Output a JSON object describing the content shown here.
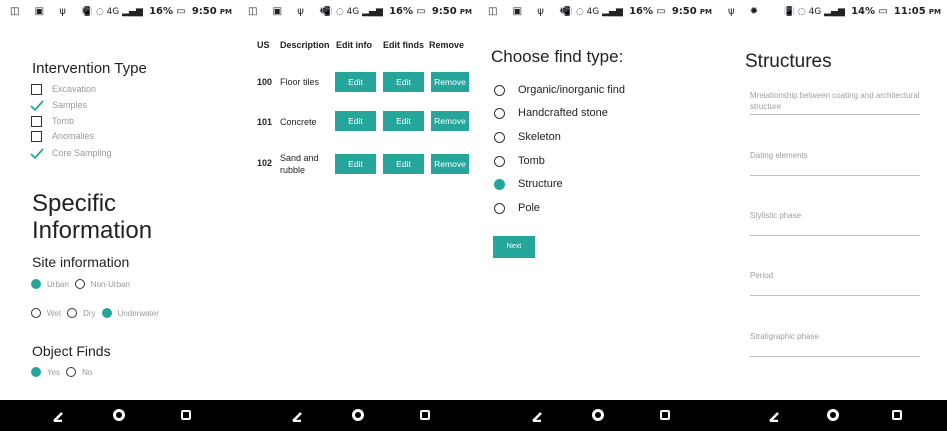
{
  "accent_color": "#26a69a",
  "status_bars": [
    {
      "left_icons": "◫ ▣ ψ ✹",
      "signal_icons": "📳 ◌ 4G ▂▄▆",
      "battery_percent": "16%",
      "battery_icon": "▭",
      "time": "9:50",
      "ampm": "PM"
    },
    {
      "left_icons": "◫ ▣ ψ ✹",
      "signal_icons": "📳 ◌ 4G ▂▄▆",
      "battery_percent": "16%",
      "battery_icon": "▭",
      "time": "9:50",
      "ampm": "PM"
    },
    {
      "left_icons": "◫ ▣ ψ ✹",
      "signal_icons": "📳 ◌ 4G ▂▄▆",
      "battery_percent": "16%",
      "battery_icon": "▭",
      "time": "9:50",
      "ampm": "PM"
    },
    {
      "left_icons": "ψ ✹",
      "signal_icons": "📳 ◌ 4G ▂▄▆",
      "battery_percent": "14%",
      "battery_icon": "▭",
      "time": "11:05",
      "ampm": "PM"
    }
  ],
  "screen1": {
    "intervention_title": "Intervention Type",
    "intervention_items": [
      {
        "label": "Excavation",
        "checked": false
      },
      {
        "label": "Samples",
        "checked": true
      },
      {
        "label": "Tomb",
        "checked": false
      },
      {
        "label": "Anomalies",
        "checked": false
      },
      {
        "label": "Core Sampling",
        "checked": true
      }
    ],
    "specific_title_line1": "Specific",
    "specific_title_line2": "Information",
    "site_info_title": "Site information",
    "urban_option": "Urban",
    "non_urban_option": "Non-Urban",
    "wet_option": "Wet",
    "dry_option": "Dry",
    "underwater_option": "Underwater",
    "object_finds_title": "Object Finds",
    "yes_option": "Yes",
    "no_option": "No"
  },
  "screen2": {
    "headers": {
      "us": "US",
      "description": "Description",
      "edit_info": "Edit info",
      "edit_finds": "Edit finds",
      "remove": "Remove"
    },
    "rows": [
      {
        "us": "100",
        "desc_line1": "Floor tiles",
        "desc_line2": "",
        "edit": "Edit",
        "edit2": "Edit",
        "remove": "Remove"
      },
      {
        "us": "101",
        "desc_line1": "Concrete",
        "desc_line2": "",
        "edit": "Edit",
        "edit2": "Edit",
        "remove": "Remove"
      },
      {
        "us": "102",
        "desc_line1": "Sand and",
        "desc_line2": "rubble",
        "edit": "Edit",
        "edit2": "Edit",
        "remove": "Remove"
      }
    ]
  },
  "screen3": {
    "title": "Choose find type:",
    "options": [
      {
        "label": "Organic/inorganic find",
        "selected": false
      },
      {
        "label": "Handcrafted stone",
        "selected": false
      },
      {
        "label": "Skeleton",
        "selected": false
      },
      {
        "label": "Tomb",
        "selected": false
      },
      {
        "label": "Structure",
        "selected": true
      },
      {
        "label": "Pole",
        "selected": false
      }
    ],
    "next_label": "Next"
  },
  "screen4": {
    "title": "Structures",
    "fields": [
      {
        "placeholder": "Mrelationship between coating and architectural structure"
      },
      {
        "placeholder": "Dating elements"
      },
      {
        "placeholder": "Stylistic phase"
      },
      {
        "placeholder": "Period"
      },
      {
        "placeholder": "Stratigraphic phase"
      }
    ]
  },
  "navbar": {
    "back_icon": "back-triangle",
    "home_icon": "home-circle",
    "recent_icon": "recent-square"
  }
}
